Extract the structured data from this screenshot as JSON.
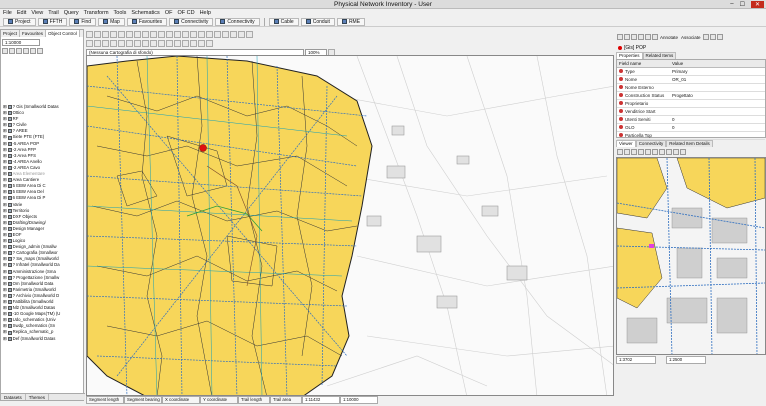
{
  "window": {
    "title": "Physical Network Inventory - User",
    "min": "–",
    "max": "☐",
    "close": "✕"
  },
  "menu": [
    "File",
    "Edit",
    "View",
    "Trail",
    "Query",
    "Transform",
    "Tools",
    "Schematics",
    "OF",
    "OF CD",
    "Help"
  ],
  "toolbar": [
    {
      "label": "Project"
    },
    {
      "label": "FFTH"
    },
    {
      "label": "Find"
    },
    {
      "label": "Map"
    },
    {
      "label": "Favourites"
    },
    {
      "label": "Connectivity"
    },
    {
      "label": "Connectivity"
    },
    {
      "label": "Cable"
    },
    {
      "label": "Conduit"
    },
    {
      "label": "RME"
    }
  ],
  "left_panel": {
    "tabs": [
      "Project",
      "Favourites",
      "Object Control"
    ],
    "scale": "1:10000",
    "bottom_tabs": [
      "Datasets",
      "Themes"
    ],
    "tree": [
      {
        "label": "? Gis (Smallworld Datas",
        "gray": false
      },
      {
        "label": "Ottico",
        "gray": false
      },
      {
        "label": "RF",
        "gray": false
      },
      {
        "label": "? Civile",
        "gray": false
      },
      {
        "label": "? AREE",
        "gray": false
      },
      {
        "label": "Siete PTE (FTE)",
        "gray": false
      },
      {
        "label": "-5 AREA POP",
        "gray": false
      },
      {
        "label": "-2 Area PFP",
        "gray": false
      },
      {
        "label": "-3 Area PFS",
        "gray": false
      },
      {
        "label": "-4 AREA Anello",
        "gray": false
      },
      {
        "label": "-2 AREA Cavo",
        "gray": false
      },
      {
        "label": "Area Elementare",
        "gray": true
      },
      {
        "label": "Area Cantiere",
        "gray": false
      },
      {
        "label": "5 EBW Area Di C",
        "gray": false
      },
      {
        "label": "5 EBW Area Del",
        "gray": false
      },
      {
        "label": "6 EBW Area Di P",
        "gray": false
      },
      {
        "label": "Varie",
        "gray": false
      },
      {
        "label": "Territorio",
        "gray": false
      },
      {
        "label": "DXF Objects",
        "gray": false
      },
      {
        "label": "Drafting/Drawing/",
        "gray": false
      },
      {
        "label": "Design Manager",
        "gray": false
      },
      {
        "label": "EOF",
        "gray": false
      },
      {
        "label": "Logico",
        "gray": false
      },
      {
        "label": "Design_admin (Smallw",
        "gray": false
      },
      {
        "label": "? Cartografia (Smallwor",
        "gray": false
      },
      {
        "label": "? Sw_maps (Smallworld",
        "gray": false
      },
      {
        "label": "? Infratel (Smallworld Da",
        "gray": false
      },
      {
        "label": "Amministrazione (Sma",
        "gray": false
      },
      {
        "label": "? Progettazione (Smallw",
        "gray": false
      },
      {
        "label": "Om (Smallworld Data",
        "gray": false
      },
      {
        "label": "Parimetria (Smallworld",
        "gray": false
      },
      {
        "label": "? Archivio (Smallworld D",
        "gray": false
      },
      {
        "label": "Fattibilita (Smallworld",
        "gray": false
      },
      {
        "label": "Nl2 (Smallworld Datas",
        "gray": false
      },
      {
        "label": "-10 Google Maps(TM) (U",
        "gray": false
      },
      {
        "label": "Udo_schematics (Univ",
        "gray": false
      },
      {
        "label": "Swdp_schematics (Sn",
        "gray": false
      },
      {
        "label": "Replica_schematic_p",
        "gray": false
      },
      {
        "label": "Def (Smallworld Datas",
        "gray": false
      }
    ]
  },
  "map_toolbar": {
    "cartography": "(Nessuna Cartografia di sfondo)",
    "zoom": "100%"
  },
  "status_bar": [
    {
      "label": "Segment length",
      "w": false
    },
    {
      "label": "Segment bearing",
      "w": false
    },
    {
      "label": "X coordinate",
      "w": false
    },
    {
      "label": "Y coordinate",
      "w": false
    },
    {
      "label": "Trail length",
      "w": false
    },
    {
      "label": "Trail area",
      "w": false
    },
    {
      "label": "1:11432",
      "w": true
    },
    {
      "label": "1:10000",
      "w": true
    }
  ],
  "right_panel": {
    "annotate": "Annotate",
    "associate": "Associate",
    "object_title": "[Gis] POP",
    "tabs": [
      "Properties",
      "Related Items"
    ],
    "columns": {
      "field": "Field name",
      "value": "Value"
    },
    "rows": [
      {
        "field": "Type",
        "value": "Primary"
      },
      {
        "field": "Nome",
        "value": "OR_01"
      },
      {
        "field": "Nome Esterno",
        "value": ""
      },
      {
        "field": "Construction Status",
        "value": "Progettato"
      },
      {
        "field": "Proprietario",
        "value": ""
      },
      {
        "field": "Venditrice Start",
        "value": ""
      },
      {
        "field": "Utenti Serviti",
        "value": "0"
      },
      {
        "field": "OLO",
        "value": "0"
      },
      {
        "field": "Particella Top",
        "value": ""
      }
    ],
    "viewer_tabs": [
      "Viewer",
      "Connectivity",
      "Related Item Details"
    ],
    "viewer_status": [
      "1:3702",
      "1:2500"
    ]
  },
  "colors": {
    "area_fill": "#f7d65a",
    "area_border": "#333333",
    "pop_marker": "#e01010",
    "network": "#2f6fc0"
  }
}
